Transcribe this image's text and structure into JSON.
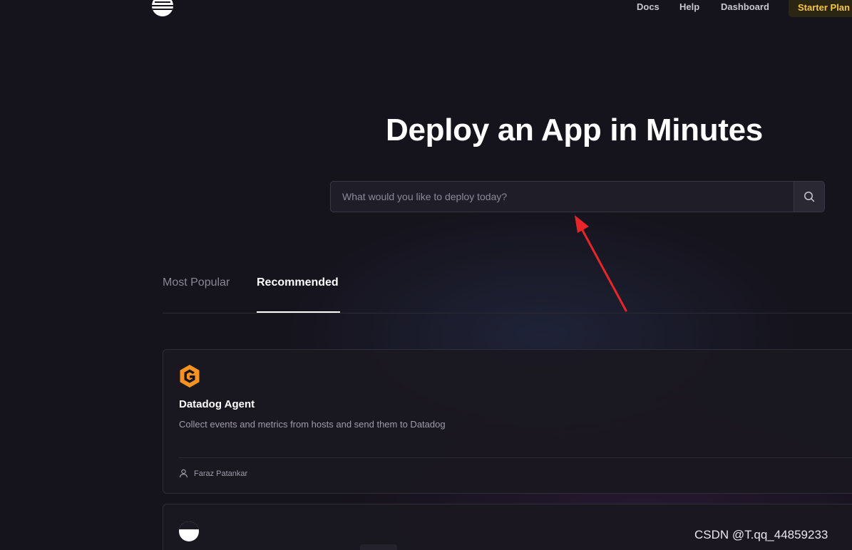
{
  "header": {
    "nav": {
      "docs": "Docs",
      "help": "Help",
      "dashboard": "Dashboard"
    },
    "plan_badge": "Starter Plan"
  },
  "hero": {
    "title": "Deploy an App in Minutes",
    "search": {
      "placeholder": "What would you like to deploy today?",
      "value": ""
    }
  },
  "tabs": [
    {
      "label": "Most Popular",
      "active": false
    },
    {
      "label": "Recommended",
      "active": true
    }
  ],
  "cards": [
    {
      "icon": "datadog-g-logo-icon",
      "title": "Datadog Agent",
      "description": "Collect events and metrics from hosts and send them to Datadog",
      "author": "Faraz Patankar"
    },
    {
      "icon": "half-moon-logo-icon"
    }
  ],
  "colors": {
    "background": "#15131c",
    "accent": "#f5c542",
    "annotation_arrow": "#e8262a",
    "datadog_orange": "#f7931e"
  },
  "watermark": "CSDN @T.qq_44859233"
}
